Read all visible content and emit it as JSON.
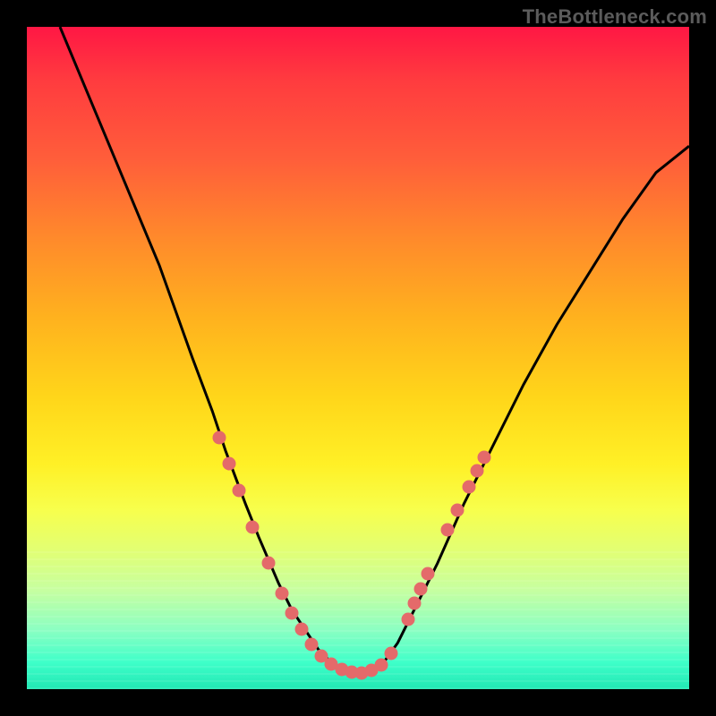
{
  "watermark": {
    "text": "TheBottleneck.com"
  },
  "colors": {
    "dot": "#e46a6a",
    "curve": "#000000",
    "frame": "#000000"
  },
  "chart_data": {
    "type": "line",
    "title": "",
    "xlabel": "",
    "ylabel": "",
    "xlim": [
      0,
      100
    ],
    "ylim": [
      0,
      100
    ],
    "grid": false,
    "legend": false,
    "series": [
      {
        "name": "curve",
        "x": [
          5,
          10,
          15,
          20,
          25,
          28,
          30,
          33,
          35,
          38,
          40,
          42,
          44,
          46,
          48,
          50,
          52,
          54,
          56,
          58,
          62,
          66,
          70,
          75,
          80,
          85,
          90,
          95,
          100
        ],
        "y": [
          100,
          88,
          76,
          64,
          50,
          42,
          36,
          28,
          23,
          16,
          12,
          9,
          6,
          4,
          3,
          2.4,
          3,
          4.2,
          7,
          11,
          19,
          28,
          36,
          46,
          55,
          63,
          71,
          78,
          82
        ]
      }
    ],
    "points": [
      {
        "x": 29.0,
        "y": 38.0
      },
      {
        "x": 30.5,
        "y": 34.0
      },
      {
        "x": 32.0,
        "y": 30.0
      },
      {
        "x": 34.0,
        "y": 24.5
      },
      {
        "x": 36.5,
        "y": 19.0
      },
      {
        "x": 38.5,
        "y": 14.5
      },
      {
        "x": 40.0,
        "y": 11.5
      },
      {
        "x": 41.5,
        "y": 9.0
      },
      {
        "x": 43.0,
        "y": 6.8
      },
      {
        "x": 44.5,
        "y": 5.0
      },
      {
        "x": 46.0,
        "y": 3.8
      },
      {
        "x": 47.5,
        "y": 3.0
      },
      {
        "x": 49.0,
        "y": 2.6
      },
      {
        "x": 50.5,
        "y": 2.5
      },
      {
        "x": 52.0,
        "y": 2.8
      },
      {
        "x": 53.5,
        "y": 3.6
      },
      {
        "x": 55.0,
        "y": 5.4
      },
      {
        "x": 57.5,
        "y": 10.5
      },
      {
        "x": 58.5,
        "y": 13.0
      },
      {
        "x": 59.5,
        "y": 15.2
      },
      {
        "x": 60.5,
        "y": 17.5
      },
      {
        "x": 63.5,
        "y": 24.0
      },
      {
        "x": 65.0,
        "y": 27.0
      },
      {
        "x": 66.8,
        "y": 30.5
      },
      {
        "x": 68.0,
        "y": 33.0
      },
      {
        "x": 69.0,
        "y": 35.0
      }
    ]
  }
}
